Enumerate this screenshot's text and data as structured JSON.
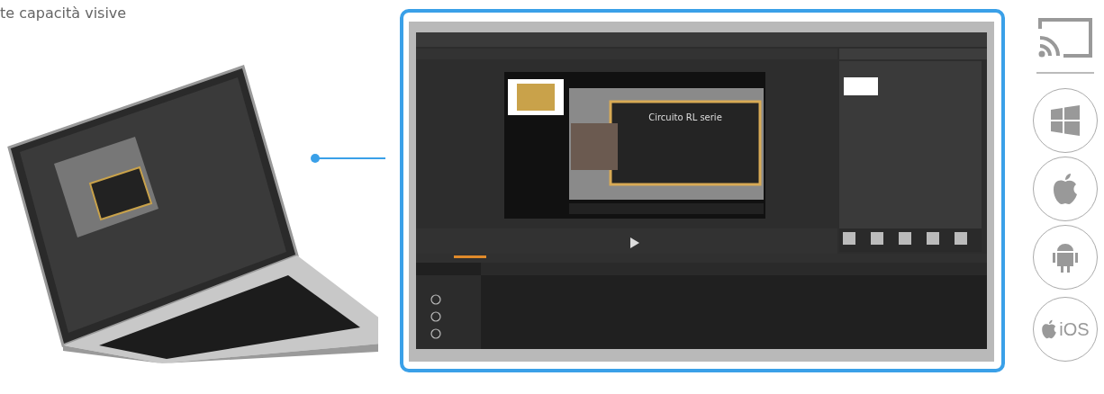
{
  "intro_text": "te capacità visive",
  "app_preview": {
    "slide_title": "Circuito RL serie"
  },
  "platforms": [
    {
      "kind": "cast"
    },
    {
      "kind": "windows"
    },
    {
      "kind": "apple"
    },
    {
      "kind": "android"
    },
    {
      "kind": "ios",
      "label": "iOS"
    }
  ]
}
